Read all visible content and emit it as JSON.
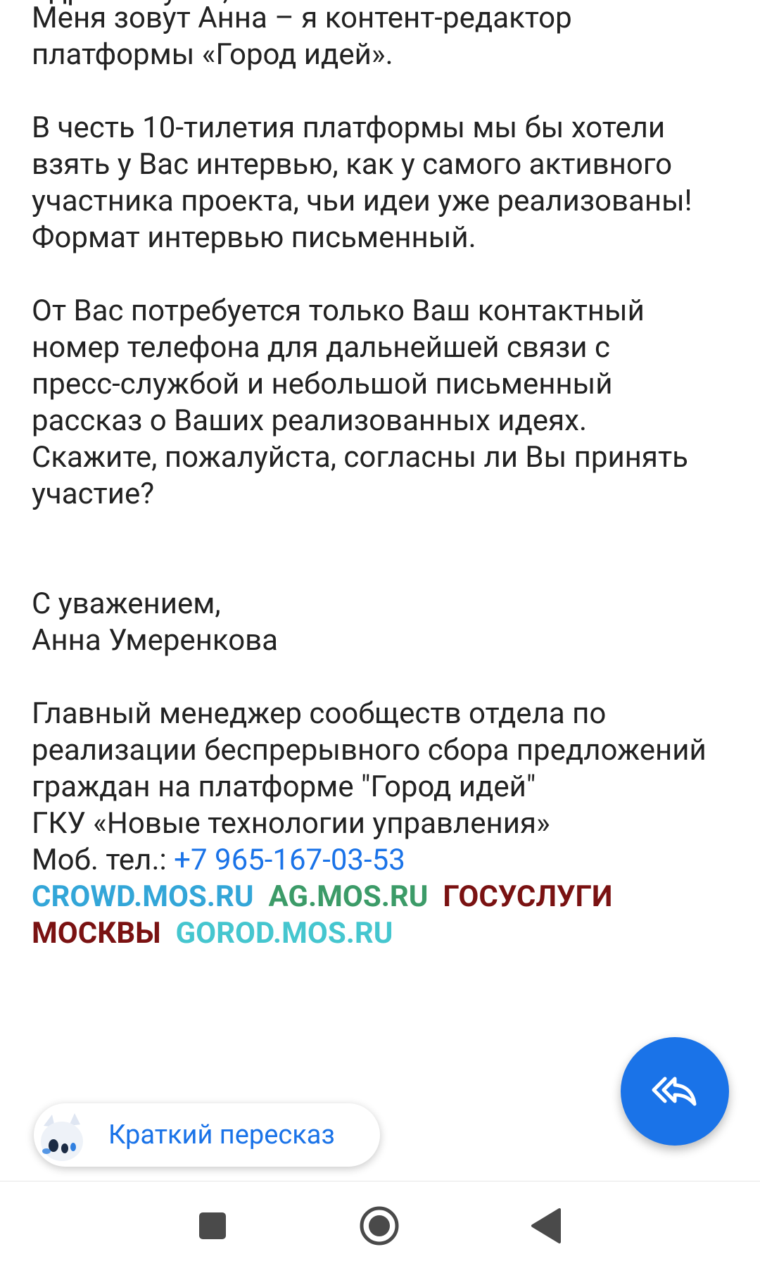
{
  "email": {
    "partial_top_line": "Здравствуйте,",
    "intro_lines": [
      "Меня зовут Анна – я контент-редактор",
      "платформы «Город идей»."
    ],
    "para2_lines": [
      "В честь 10-тилетия платформы мы бы хотели",
      "взять у Вас интервью, как у самого активного",
      "участника проекта, чьи идеи уже реализованы!",
      "Формат интервью письменный."
    ],
    "para3_lines": [
      "От Вас потребуется только Ваш контактный",
      "номер телефона для дальнейшей связи с",
      "пресс-службой и небольшой письменный",
      "рассказ о Ваших реализованных идеях.",
      "Скажите, пожалуйста, согласны ли Вы принять",
      "участие?"
    ],
    "signature": {
      "greeting": "С уважением,",
      "name": "Анна Умеренкова",
      "position_lines": [
        "Главный менеджер сообществ отдела по",
        "реализации беспрерывного сбора предложений",
        "граждан на платформе \"Город идей\"",
        "ГКУ «Новые технологии управления»"
      ],
      "phone_label": "Моб. тел.: ",
      "phone_number": "+7 965-167-03-53",
      "links": {
        "crowd": "CROWD.MOS.RU",
        "ag": "AG.MOS.RU",
        "gosuslugi_1": "ГОСУСЛУГИ",
        "gosuslugi_2": "МОСКВЫ",
        "gorod": "GOROD.MOS.RU"
      }
    }
  },
  "summary_chip": {
    "label": "Краткий пересказ",
    "icon": "alice-mascot-icon"
  },
  "reply_fab": {
    "icon": "reply-all-icon"
  },
  "navbar": {
    "recents_icon": "square-icon",
    "home_icon": "circle-icon",
    "back_icon": "triangle-back-icon"
  },
  "colors": {
    "accent": "#1a73e8",
    "text": "#222222",
    "crowd": "#33a6d8",
    "ag": "#3c9b68",
    "gosuslugi": "#7a1212",
    "gorod": "#45c6cf"
  }
}
